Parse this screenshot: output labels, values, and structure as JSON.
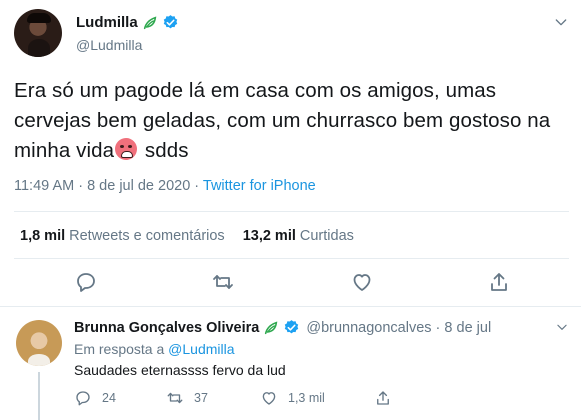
{
  "tweet": {
    "display_name": "Ludmilla",
    "handle": "@Ludmilla",
    "text_before_emoji": "Era só um pagode lá em casa com os amigos, umas cervejas bem geladas, com um churrasco bem gostoso na minha vida",
    "text_after_emoji": " sdds",
    "emoji": "hot-face-emoji",
    "time": "11:49 AM · 8 de jul de 2020 · ",
    "source": "Twitter for iPhone",
    "stats": {
      "retweets_count": "1,8 mil",
      "retweets_label": "Retweets e comentários",
      "likes_count": "13,2 mil",
      "likes_label": "Curtidas"
    },
    "actions": [
      "reply-icon",
      "retweet-icon",
      "like-icon",
      "share-icon"
    ]
  },
  "reply": {
    "display_name": "Brunna Gonçalves Oliveira",
    "handle": "@brunnagoncalves · 8 de jul",
    "in_reply_to_prefix": "Em resposta a ",
    "in_reply_to_mention": "@Ludmilla",
    "text": "Saudades eternassss fervo da lud",
    "reply_count": "24",
    "retweet_count": "37",
    "like_count": "1,3 mil"
  },
  "colors": {
    "accent": "#1b95e0",
    "secondary_text": "#657786",
    "primary_text": "#14171a",
    "leaf_green": "#2fa84f",
    "verified_blue": "#1da1f2"
  }
}
